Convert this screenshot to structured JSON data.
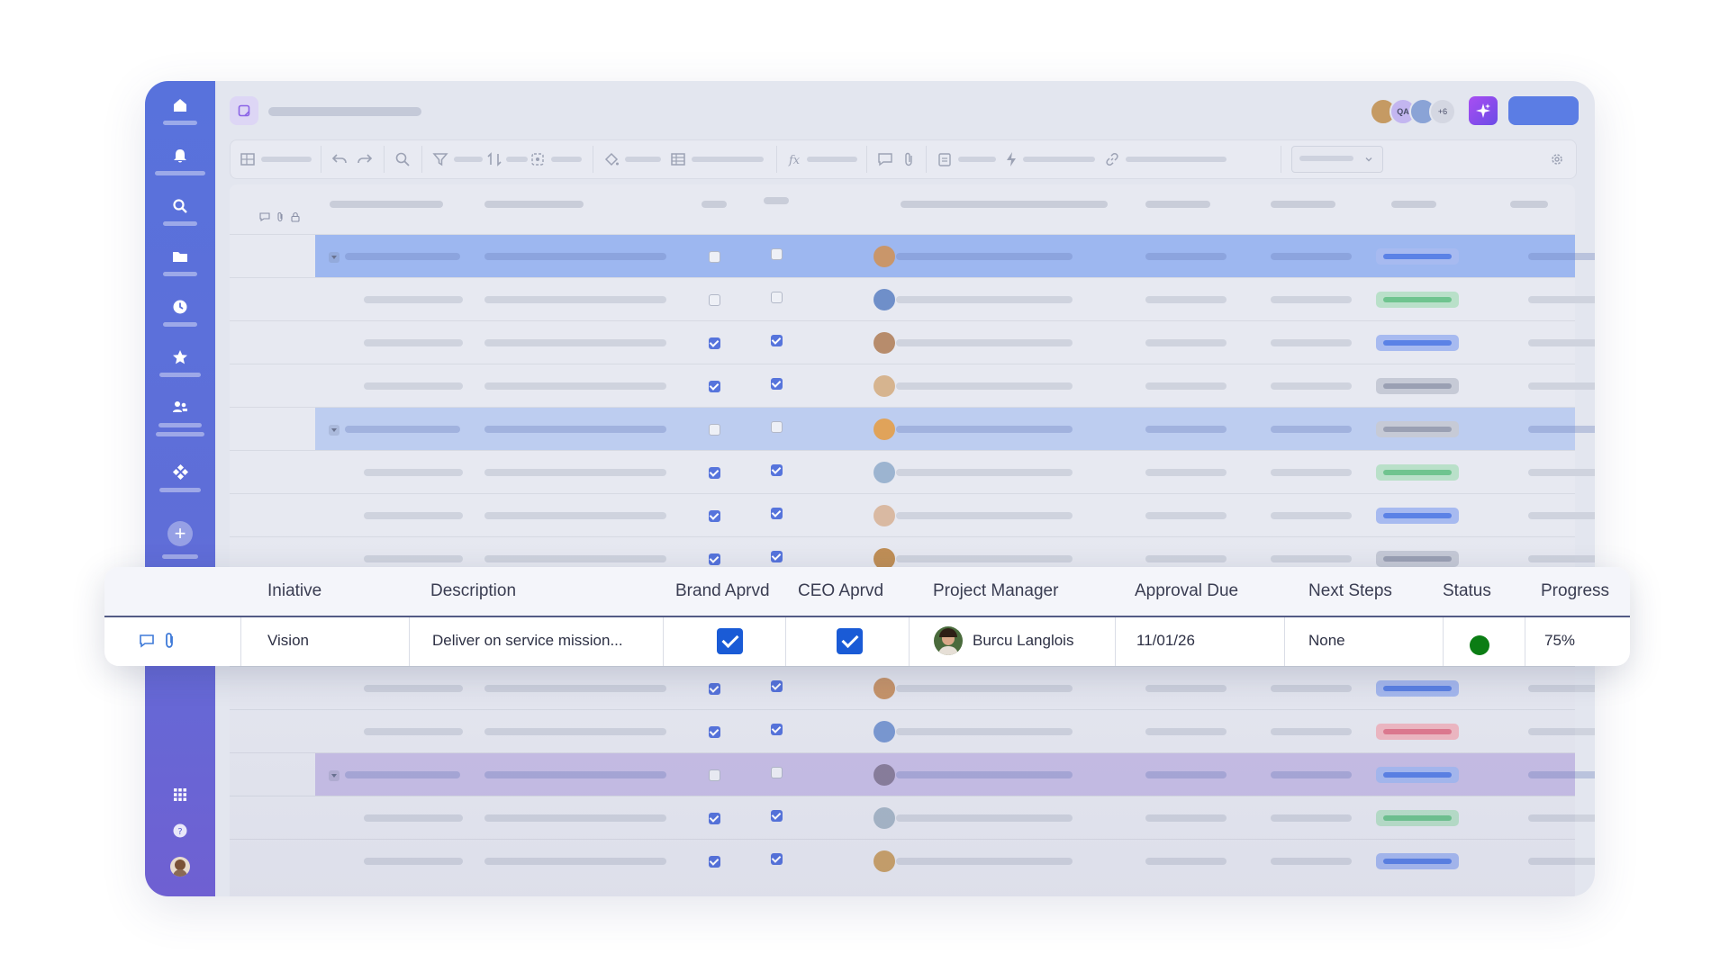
{
  "floating_table": {
    "headers": {
      "initiative": "Iniative",
      "description": "Description",
      "brand": "Brand Aprvd",
      "ceo": "CEO Aprvd",
      "pm": "Project Manager",
      "approval": "Approval Due",
      "next": "Next Steps",
      "status": "Status",
      "progress": "Progress"
    },
    "row": {
      "initiative": "Vision",
      "description": "Deliver on service mission...",
      "brand_approved": true,
      "ceo_approved": true,
      "project_manager": "Burcu Langlois",
      "approval_due": "11/01/26",
      "next_steps": "None",
      "status_color": "#0b7d14",
      "progress": "75%"
    }
  },
  "collaborators": {
    "badge_qa": "QA",
    "extra_count": "+6"
  },
  "colors": {
    "sidebar_top": "#5872dc",
    "sidebar_bottom": "#6f60d2",
    "accent_blue": "#5674dc",
    "checkbox_blue": "#1a5bd6",
    "ai_button": "#8e4cec",
    "status_green": "#0b7d14",
    "row_highlight_blue": "#9db7f0",
    "row_highlight_blue_2": "#bdcdf0",
    "row_highlight_purple": "#c8bfe6"
  }
}
